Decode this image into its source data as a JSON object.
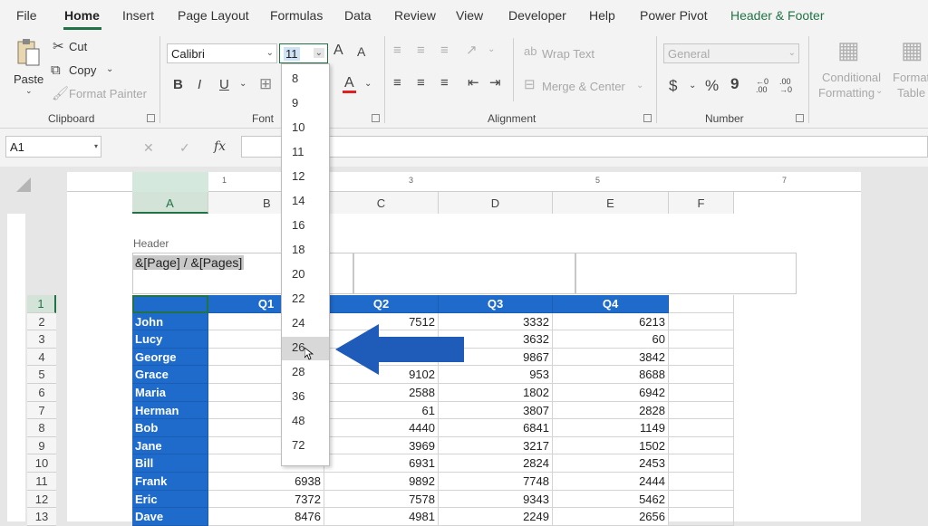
{
  "tabs": [
    "File",
    "Home",
    "Insert",
    "Page Layout",
    "Formulas",
    "Data",
    "Review",
    "View",
    "Developer",
    "Help",
    "Power Pivot",
    "Header & Footer"
  ],
  "ribbon": {
    "clipboard": {
      "paste": "Paste",
      "cut": "Cut",
      "copy": "Copy",
      "format_painter": "Format Painter",
      "label": "Clipboard"
    },
    "font": {
      "name": "Calibri",
      "size": "11",
      "grow": "A",
      "shrink": "A",
      "bold": "B",
      "italic": "I",
      "underline": "U",
      "font_color": "A",
      "label": "Font"
    },
    "alignment": {
      "wrap_text": "Wrap Text",
      "merge_center": "Merge & Center",
      "label": "Alignment"
    },
    "number": {
      "format": "General",
      "currency": "$",
      "percent": "%",
      "comma": "9",
      "inc_decimal": "←0 .00",
      "dec_decimal": ".00 →0",
      "label": "Number"
    },
    "styles": {
      "conditional_1": "Conditional",
      "conditional_2": "Formatting",
      "format_table_1": "Format",
      "format_table_2": "Table"
    }
  },
  "formula_bar": {
    "name_box": "A1",
    "cancel": "✕",
    "enter": "✓",
    "fx": "fx"
  },
  "ruler_numbers": [
    "1",
    "3",
    "5",
    "7"
  ],
  "columns": [
    "A",
    "B",
    "C",
    "D",
    "E",
    "F"
  ],
  "header": {
    "label": "Header",
    "text": "&[Page] / &[Pages]"
  },
  "rows": [
    "1",
    "2",
    "3",
    "4",
    "5",
    "6",
    "7",
    "8",
    "9",
    "10",
    "11",
    "12",
    "13"
  ],
  "table": {
    "headers": [
      "Q1",
      "Q2",
      "Q3",
      "Q4"
    ],
    "data": [
      {
        "name": "John",
        "q1": "",
        "q2": "7512",
        "q3": "3332",
        "q4": "6213"
      },
      {
        "name": "Lucy",
        "q1": "",
        "q2": "",
        "q3": "3632",
        "q4": "60"
      },
      {
        "name": "George",
        "q1": "",
        "q2": "",
        "q3": "9867",
        "q4": "3842"
      },
      {
        "name": "Grace",
        "q1": "",
        "q2": "9102",
        "q3": "953",
        "q4": "8688"
      },
      {
        "name": "Maria",
        "q1": "",
        "q2": "2588",
        "q3": "1802",
        "q4": "6942"
      },
      {
        "name": "Herman",
        "q1": "",
        "q2": "61",
        "q3": "3807",
        "q4": "2828"
      },
      {
        "name": "Bob",
        "q1": "",
        "q2": "4440",
        "q3": "6841",
        "q4": "1149"
      },
      {
        "name": "Jane",
        "q1": "",
        "q2": "3969",
        "q3": "3217",
        "q4": "1502"
      },
      {
        "name": "Bill",
        "q1": "",
        "q2": "6931",
        "q3": "2824",
        "q4": "2453"
      },
      {
        "name": "Frank",
        "q1": "6938",
        "q2": "9892",
        "q3": "7748",
        "q4": "2444"
      },
      {
        "name": "Eric",
        "q1": "7372",
        "q2": "7578",
        "q3": "9343",
        "q4": "5462"
      },
      {
        "name": "Dave",
        "q1": "8476",
        "q2": "4981",
        "q3": "2249",
        "q4": "2656"
      }
    ]
  },
  "font_size_options": [
    "8",
    "9",
    "10",
    "11",
    "12",
    "14",
    "16",
    "18",
    "20",
    "22",
    "24",
    "26",
    "28",
    "36",
    "48",
    "72"
  ],
  "font_size_hover": "26",
  "colors": {
    "accent": "#217346",
    "table_blue": "#1f6bcc",
    "arrow_blue": "#1f5bb8",
    "font_color_bar": "#e02020"
  }
}
